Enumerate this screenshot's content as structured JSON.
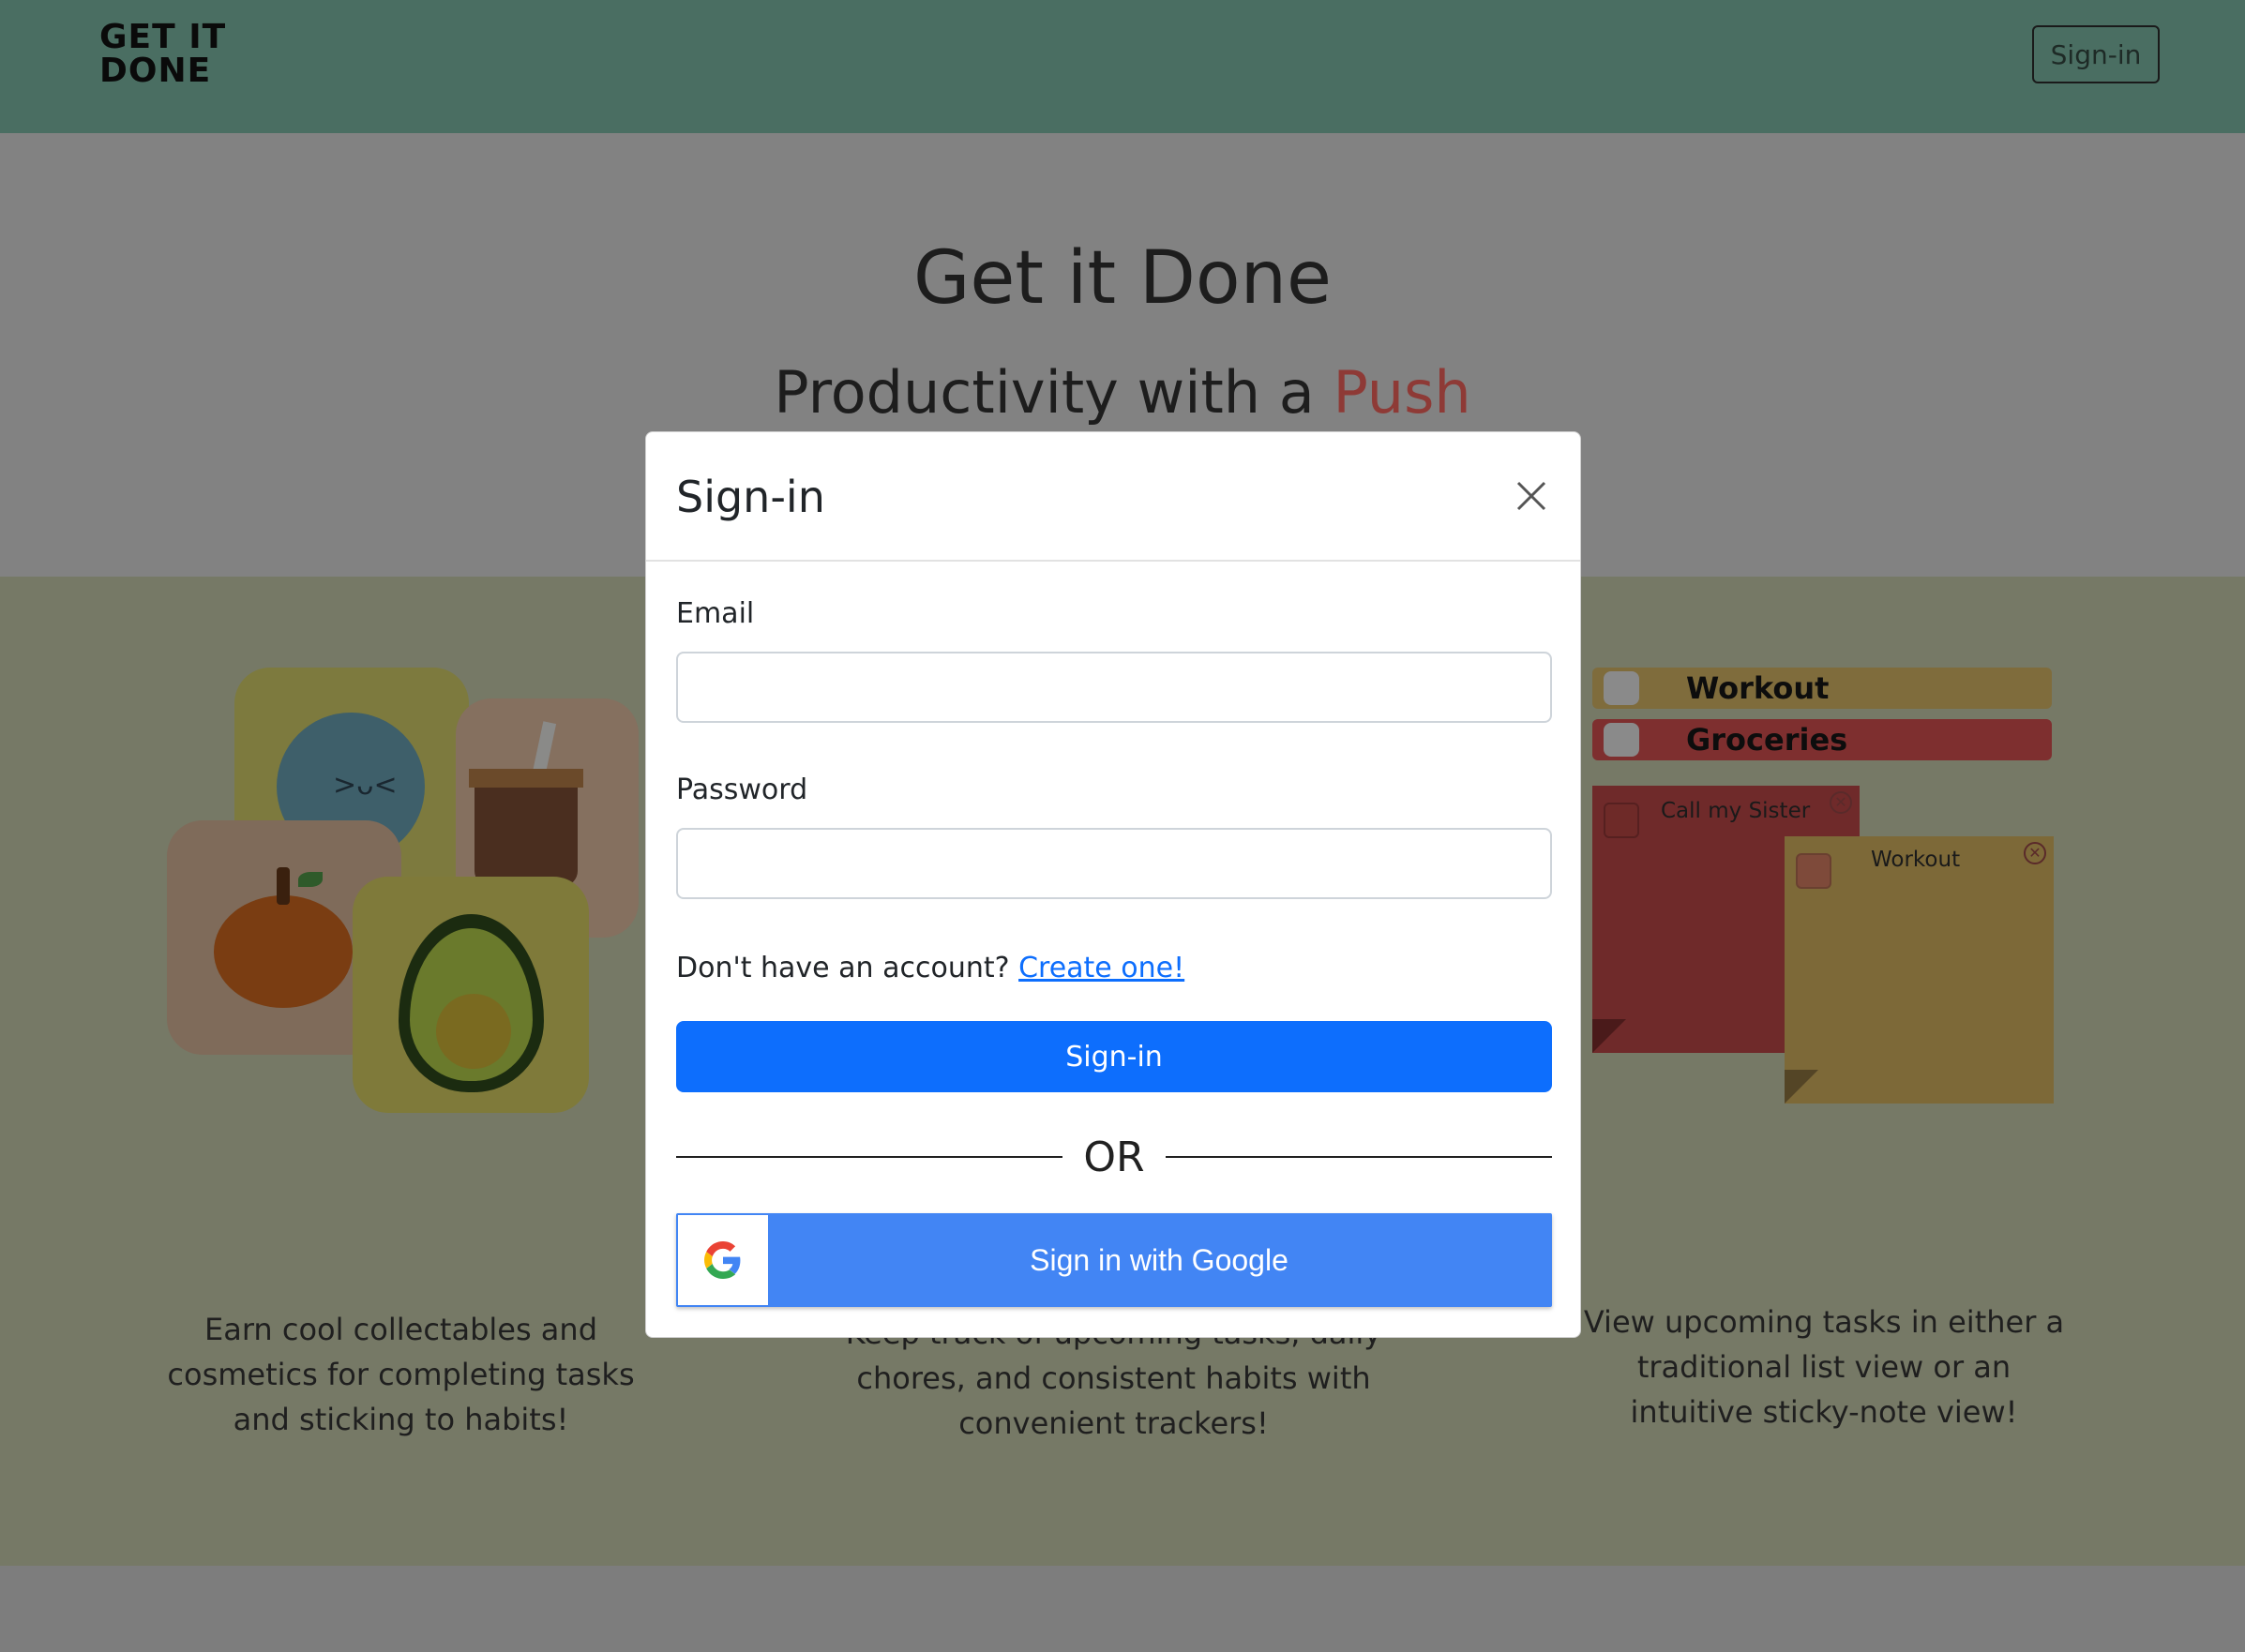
{
  "navbar": {
    "logo_line1": "GET IT",
    "logo_line2": "DONE",
    "signin_label": "Sign-in"
  },
  "hero": {
    "title": "Get it Done",
    "subtitle_prefix": "Productivity with a ",
    "subtitle_accent": "Push"
  },
  "features": [
    {
      "text": "Earn cool collectables and cosmetics for completing tasks and sticking to habits!"
    },
    {
      "text": "Keep track of upcoming tasks, daily chores, and consistent habits with convenient trackers!"
    },
    {
      "text": "View upcoming tasks in either a traditional list view or an intuitive sticky-note view!"
    }
  ],
  "task_preview": {
    "list_items": [
      "Workout",
      "Groceries"
    ],
    "sticky_notes": [
      "Call my Sister",
      "Workout"
    ]
  },
  "modal": {
    "title": "Sign-in",
    "email_label": "Email",
    "email_value": "",
    "password_label": "Password",
    "password_value": "",
    "account_prompt": "Don't have an account? ",
    "create_link": "Create one!",
    "signin_button": "Sign-in",
    "divider_text": "OR",
    "google_button": "Sign in with Google"
  },
  "colors": {
    "navbar_bg": "#4a6e62",
    "accent_push": "#8e3a36",
    "primary_button": "#0d6efd",
    "google_blue": "#4285f4",
    "link": "#0d6efd"
  }
}
